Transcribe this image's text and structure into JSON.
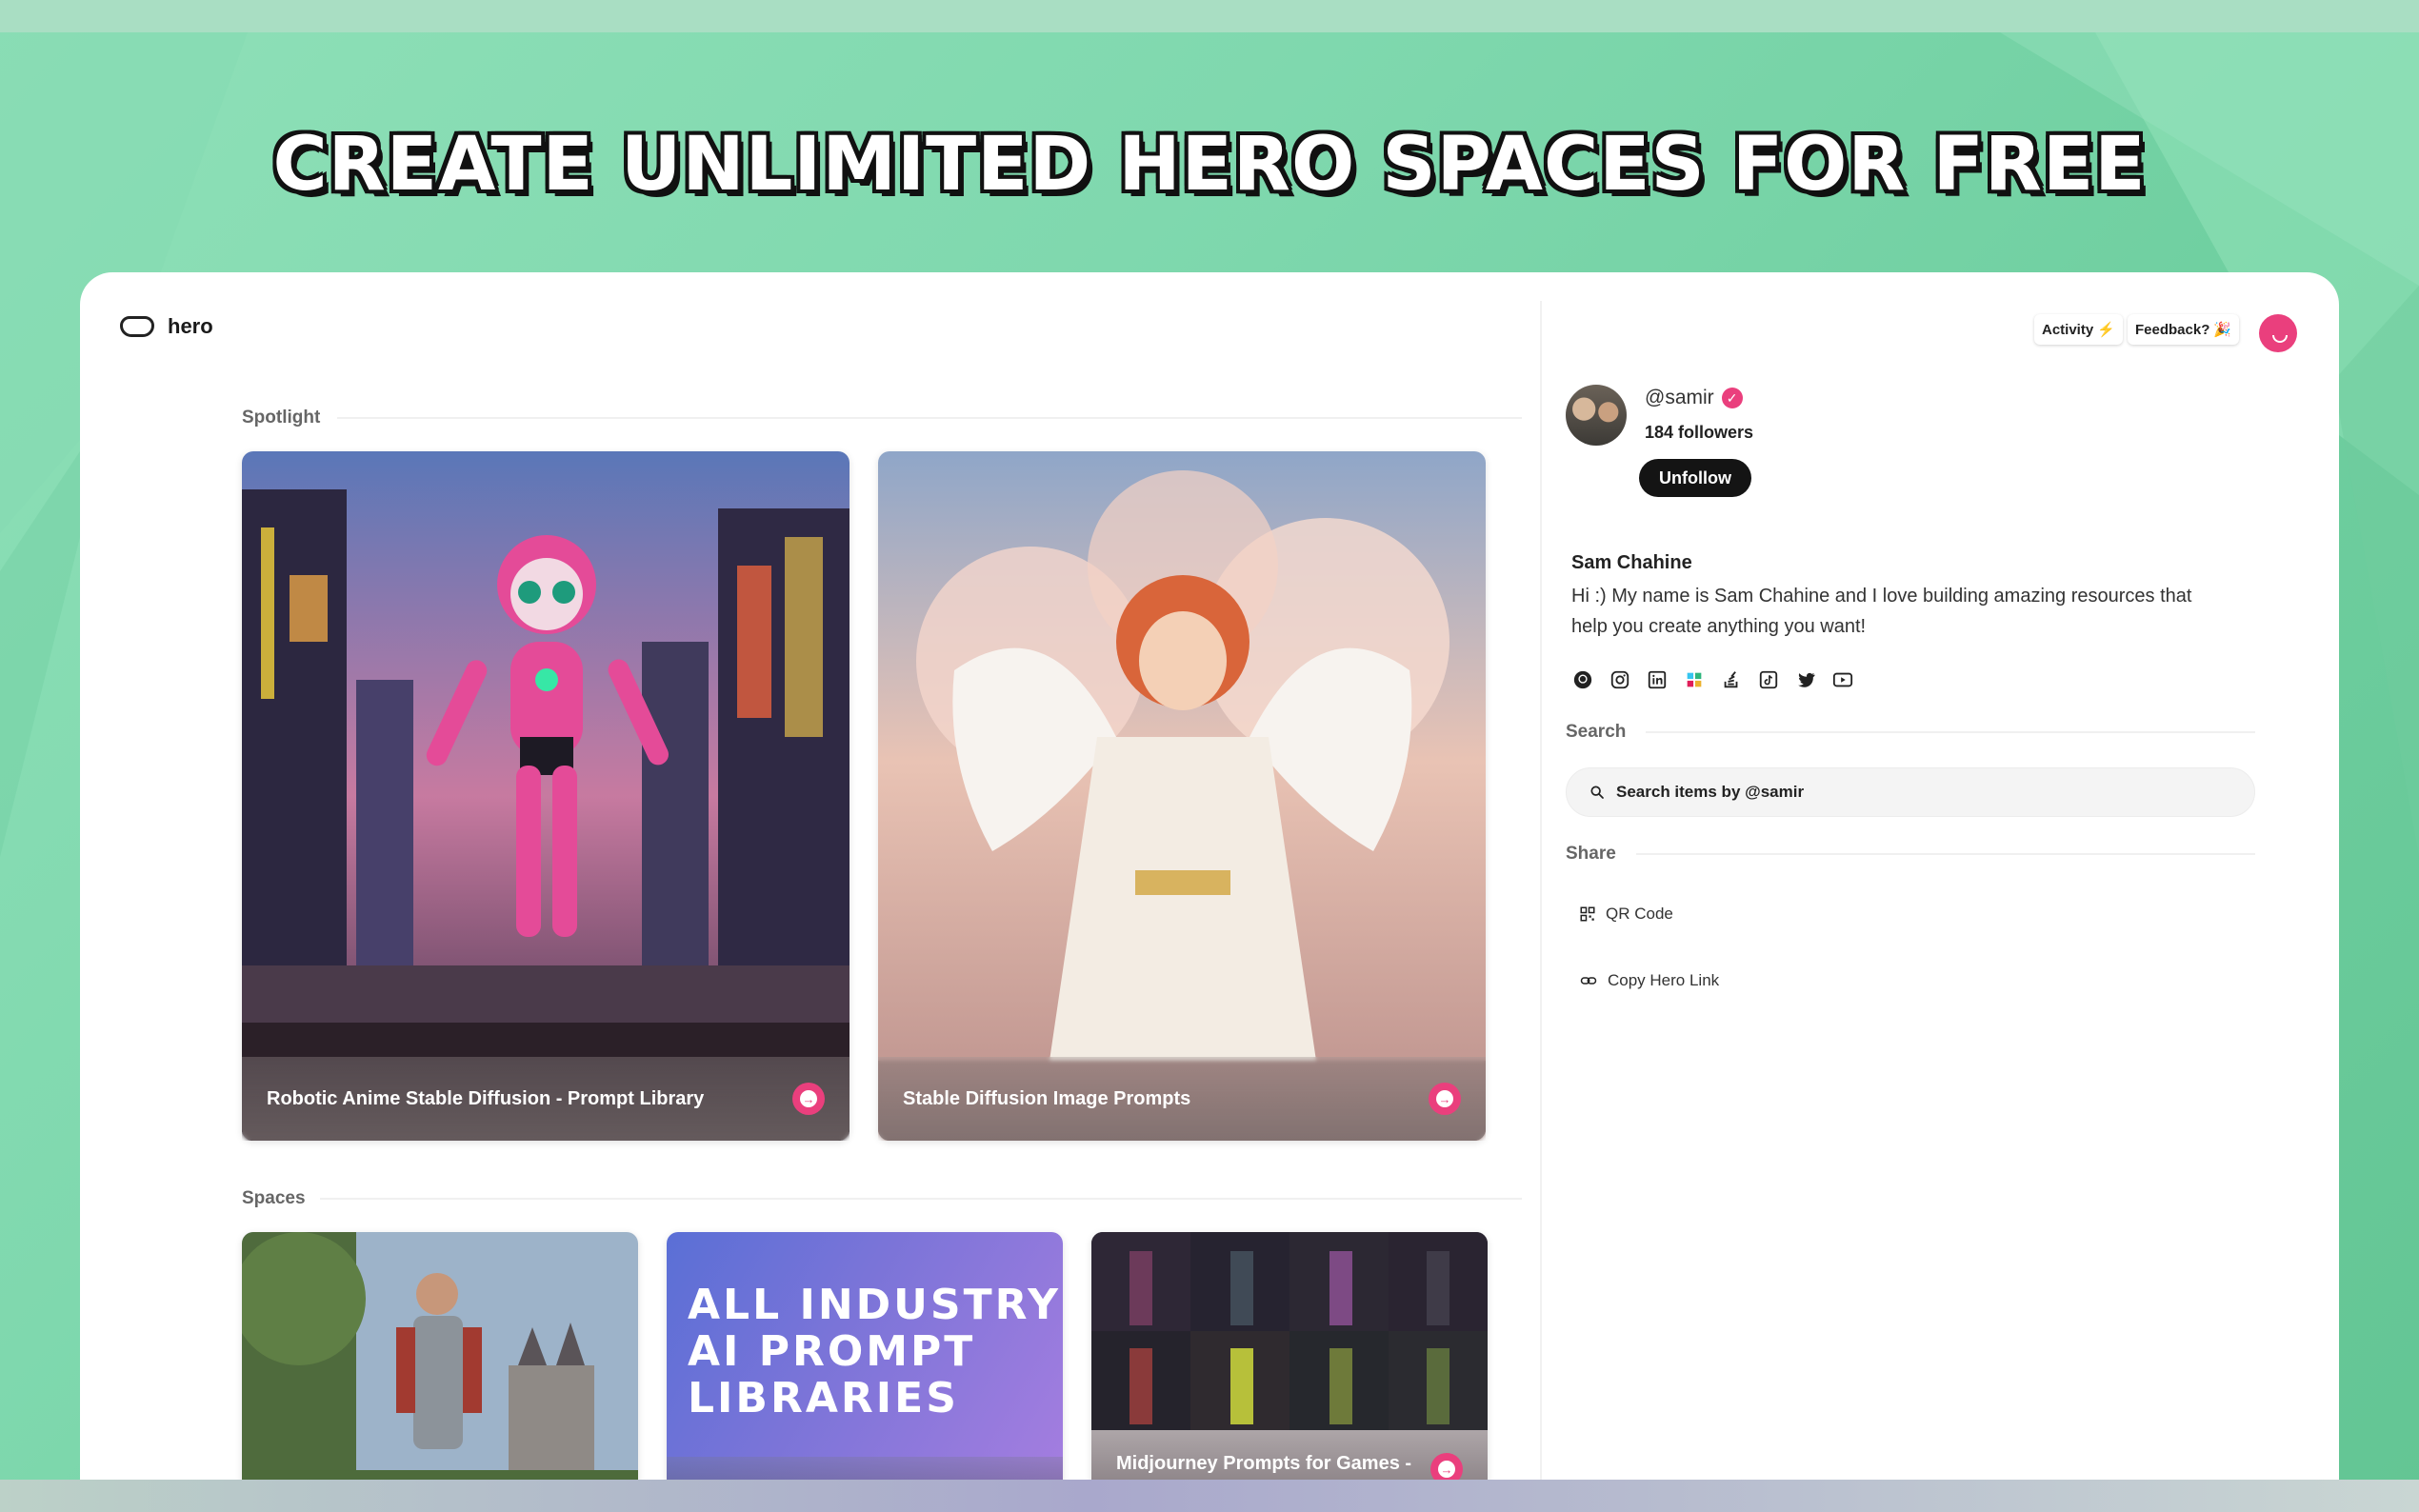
{
  "headline": "CREATE UNLIMITED HERO SPACES FOR FREE",
  "brand": {
    "name": "hero"
  },
  "topbar": {
    "activity_label": "Activity",
    "activity_emoji": "⚡",
    "feedback_label": "Feedback?",
    "feedback_emoji": "🎉"
  },
  "spotlight": {
    "title": "Spotlight",
    "items": [
      {
        "title": "Robotic Anime Stable Diffusion - Prompt Library"
      },
      {
        "title": "Stable Diffusion Image Prompts"
      }
    ]
  },
  "spaces": {
    "title": "Spaces",
    "items": [
      {
        "title": ""
      },
      {
        "title": "",
        "art_text_line1": "ALL INDUSTRY",
        "art_text_line2": "AI PROMPT",
        "art_text_line3": "LIBRARIES"
      },
      {
        "title": "Midjourney Prompts for Games -"
      }
    ]
  },
  "profile": {
    "handle": "@samir",
    "followers": "184 followers",
    "unfollow_label": "Unfollow",
    "name": "Sam Chahine",
    "bio": "Hi :) My name is Sam Chahine and I love building amazing resources that help you create anything you want!",
    "socials": [
      "github-icon",
      "instagram-icon",
      "linkedin-icon",
      "slack-icon",
      "stackoverflow-icon",
      "tiktok-icon",
      "twitter-icon",
      "youtube-icon"
    ]
  },
  "search": {
    "title": "Search",
    "placeholder": "Search items by @samir"
  },
  "share": {
    "title": "Share",
    "qr_label": "QR Code",
    "copy_label": "Copy Hero Link"
  },
  "colors": {
    "accent": "#ea3f7d",
    "background": "#7fd8ae",
    "dark_button": "#141414"
  }
}
